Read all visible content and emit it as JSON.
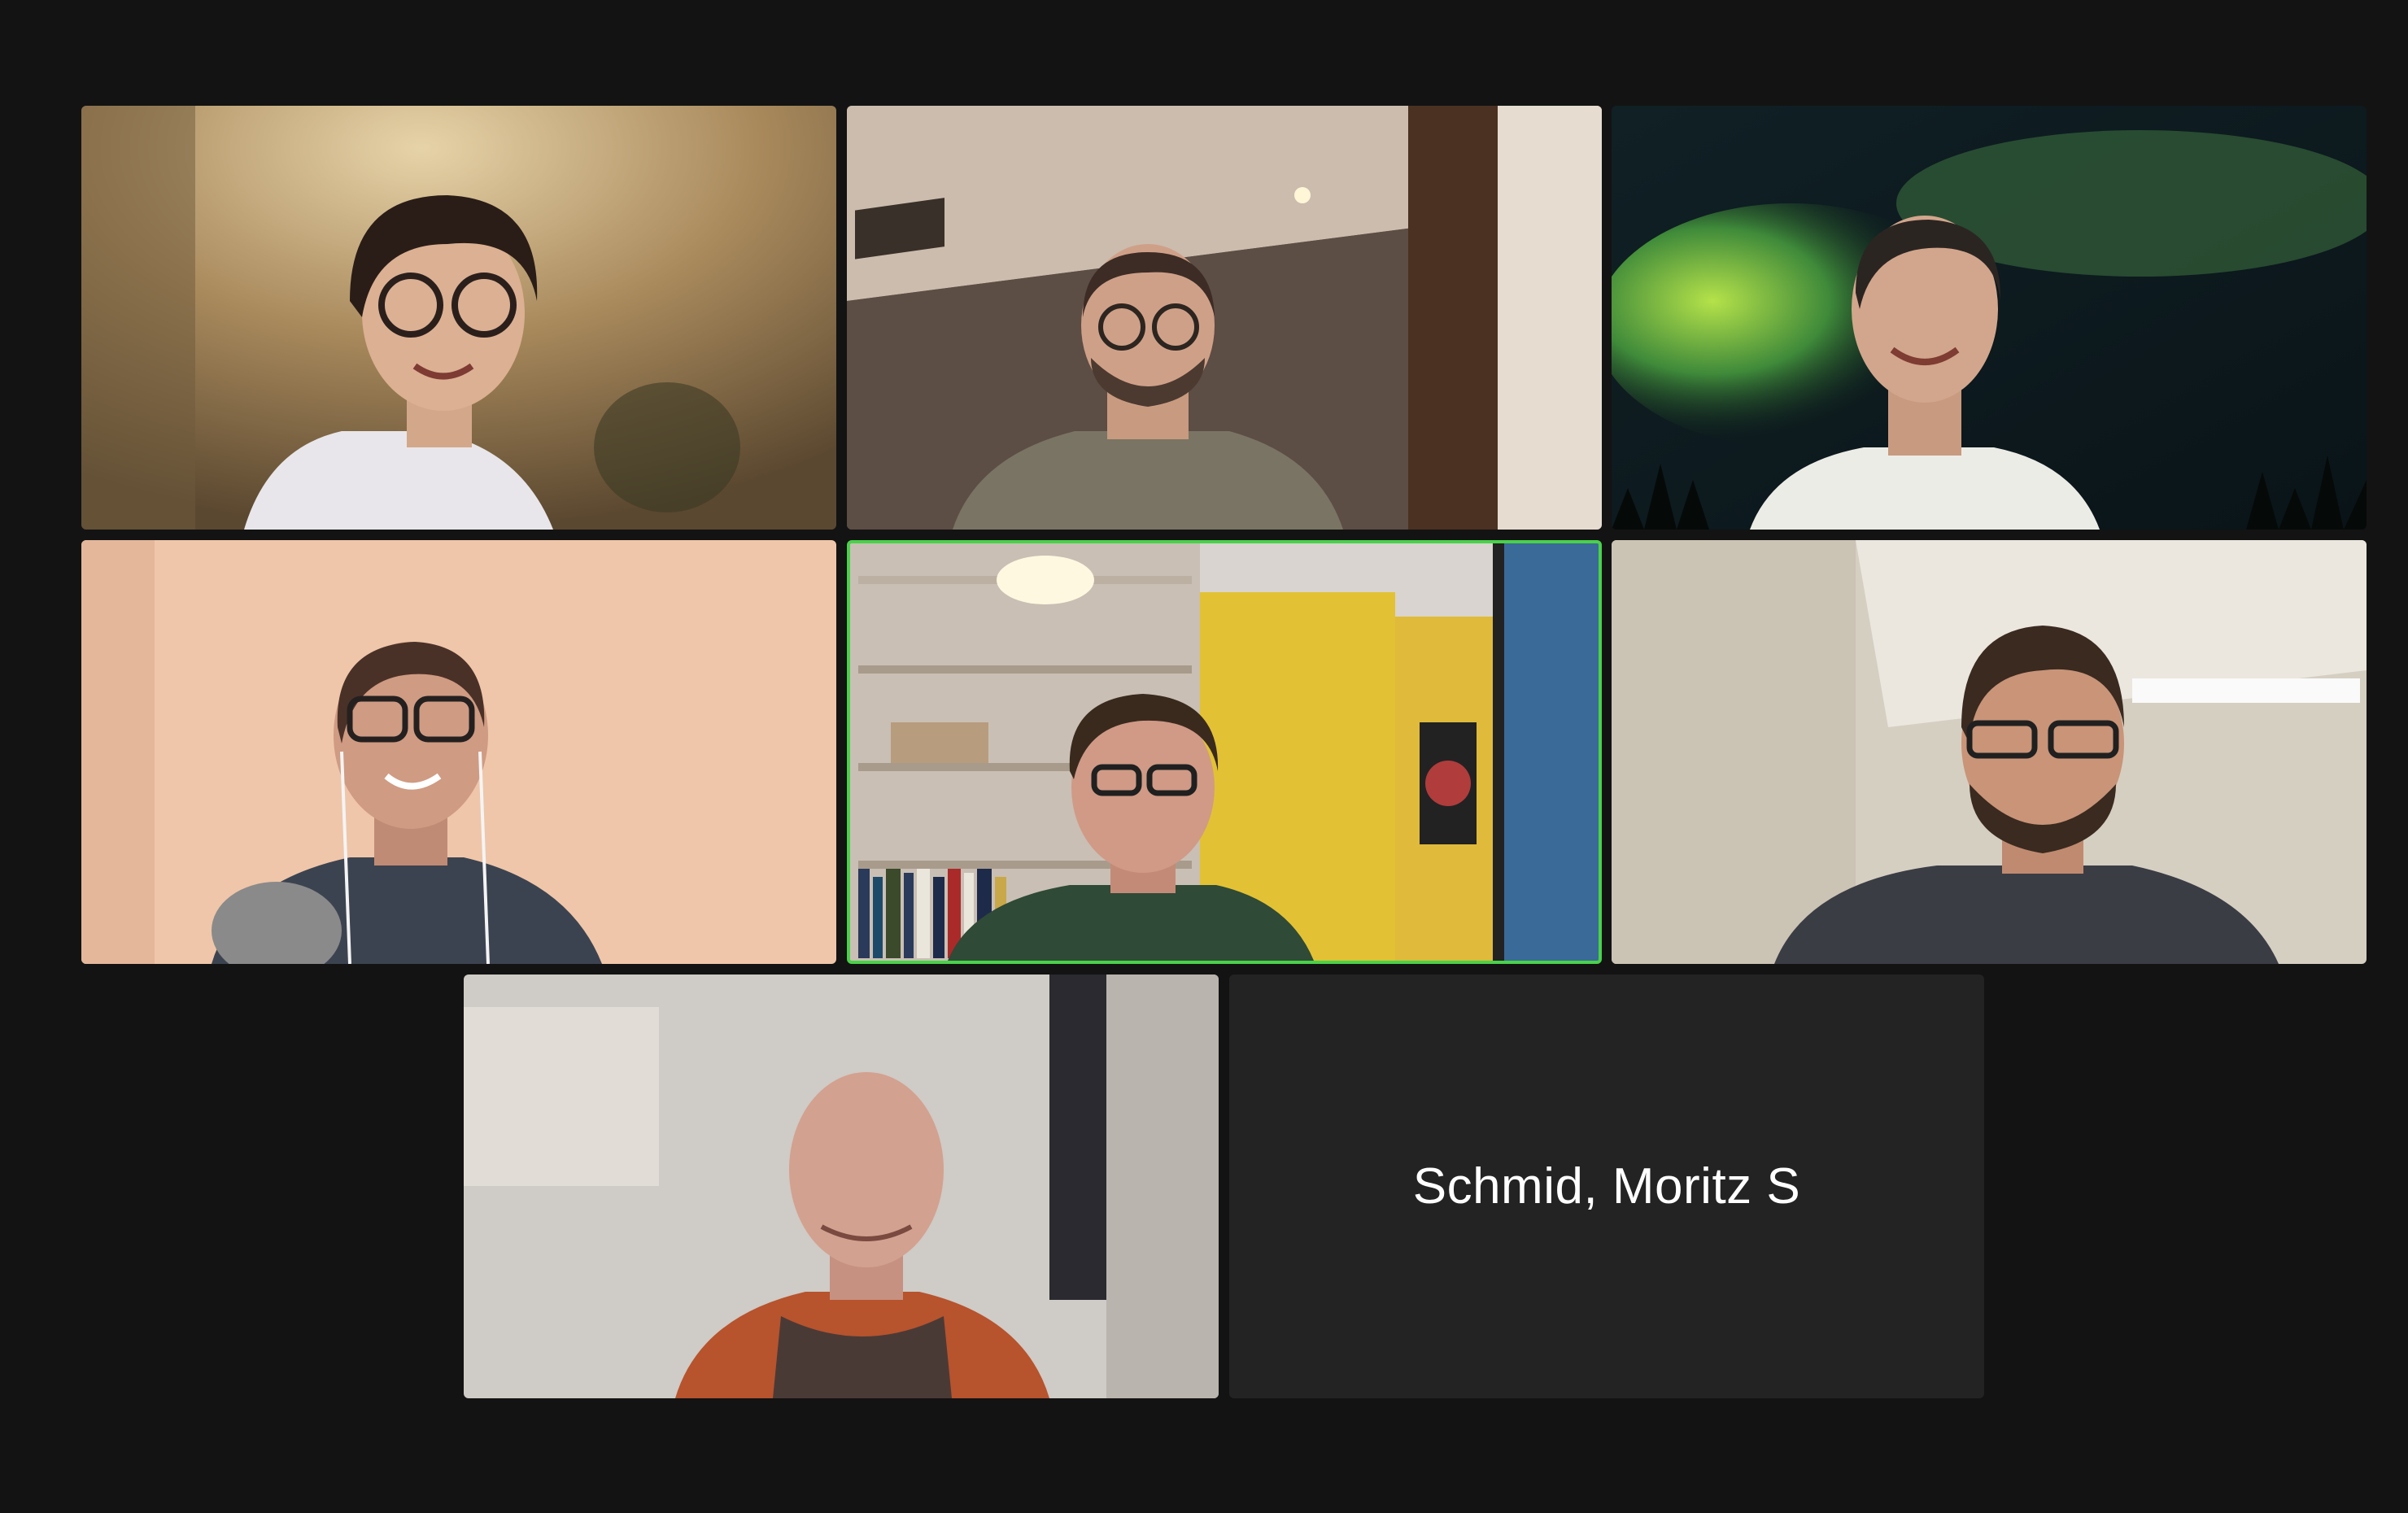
{
  "meeting": {
    "view": "gallery",
    "accent_active_speaker": "#4ad14a",
    "background": "#131313",
    "tiles": [
      {
        "kind": "video",
        "scene": "warm-room-woman-glasses"
      },
      {
        "kind": "video",
        "scene": "office-man-glasses-beard"
      },
      {
        "kind": "video",
        "scene": "aurora-background-person"
      },
      {
        "kind": "video",
        "scene": "peach-wall-woman-glasses-mic"
      },
      {
        "kind": "video",
        "scene": "bookshelf-yellow-wall-man",
        "active_speaker": true
      },
      {
        "kind": "video",
        "scene": "office-man-glasses-beard-2"
      },
      {
        "kind": "video",
        "scene": "bald-man-orange-hoodie"
      },
      {
        "kind": "name-only",
        "name": "Schmid, Moritz S"
      }
    ]
  }
}
